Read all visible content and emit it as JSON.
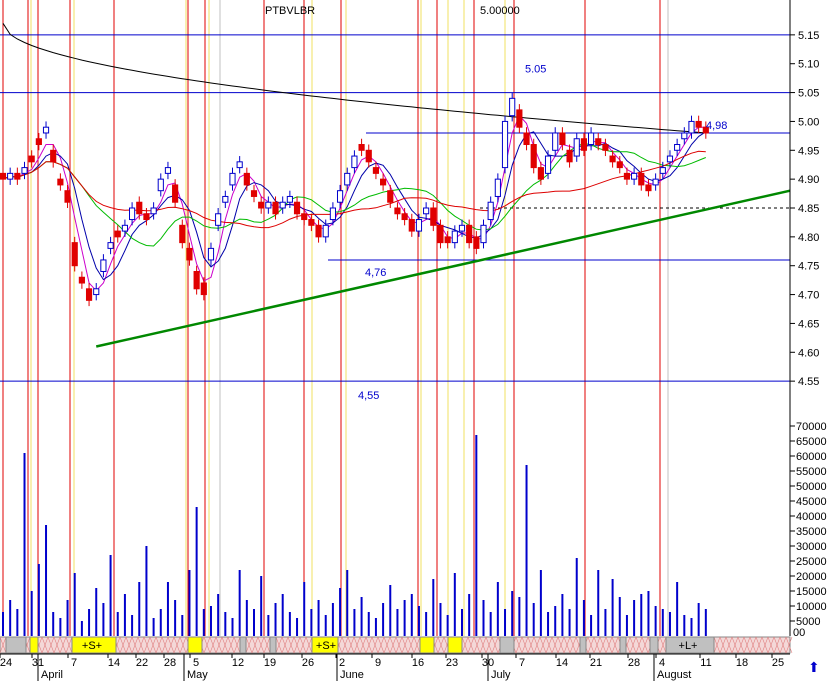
{
  "chart_data": {
    "type": "candlestick",
    "title": "PTBVLBR",
    "legend_text": "5.00000",
    "price_axis": {
      "ylim": [
        4.5,
        5.2
      ],
      "ticks": [
        4.55,
        4.6,
        4.65,
        4.7,
        4.75,
        4.8,
        4.85,
        4.9,
        4.95,
        5.0,
        5.05,
        5.1,
        5.15
      ]
    },
    "volume_axis": {
      "ylim": [
        0,
        72000
      ],
      "ticks": [
        5000,
        10000,
        15000,
        20000,
        25000,
        30000,
        35000,
        40000,
        45000,
        50000,
        55000,
        60000,
        65000,
        70000
      ]
    },
    "date_ticks": [
      "24",
      "31",
      "7",
      "14",
      "22",
      "28",
      "5",
      "12",
      "19",
      "26",
      "2",
      "9",
      "16",
      "23",
      "30",
      "7",
      "14",
      "21",
      "28",
      "4",
      "11",
      "18",
      "25"
    ],
    "month_labels": [
      "April",
      "May",
      "June",
      "July",
      "August"
    ],
    "horizontal_levels": [
      {
        "value": 5.15,
        "label": ""
      },
      {
        "value": 5.05,
        "label": "5.05"
      },
      {
        "value": 4.76,
        "label": "4,76"
      },
      {
        "value": 4.55,
        "label": "4,55"
      },
      {
        "value": 4.98,
        "label": "4,98"
      },
      {
        "value": 4.85,
        "label": ""
      }
    ],
    "trendline": {
      "from": [
        13,
        4.61
      ],
      "to": [
        133,
        4.88
      ]
    },
    "signals": [
      "+S+",
      "+S+",
      "+L+"
    ],
    "close": [
      4.9,
      4.91,
      4.9,
      4.92,
      4.93,
      4.96,
      4.99,
      4.93,
      4.89,
      4.86,
      4.75,
      4.72,
      4.69,
      4.71,
      4.76,
      4.79,
      4.8,
      4.82,
      4.85,
      4.84,
      4.83,
      4.85,
      4.9,
      4.92,
      4.86,
      4.79,
      4.76,
      4.71,
      4.7,
      4.78,
      4.84,
      4.87,
      4.91,
      4.93,
      4.89,
      4.87,
      4.85,
      4.86,
      4.84,
      4.86,
      4.87,
      4.84,
      4.83,
      4.82,
      4.8,
      4.82,
      4.85,
      4.88,
      4.91,
      4.94,
      4.95,
      4.93,
      4.91,
      4.89,
      4.86,
      4.84,
      4.83,
      4.81,
      4.83,
      4.85,
      4.82,
      4.79,
      4.79,
      4.81,
      4.82,
      4.79,
      4.78,
      4.82,
      4.86,
      4.9,
      5.0,
      5.04,
      4.99,
      4.96,
      4.92,
      4.9,
      4.94,
      4.98,
      4.96,
      4.93,
      4.97,
      4.95,
      4.98,
      4.96,
      4.95,
      4.93,
      4.92,
      4.9,
      4.91,
      4.89,
      4.88,
      4.9,
      4.92,
      4.94,
      4.96,
      4.98,
      5.0,
      4.99,
      4.98
    ],
    "open": [
      4.91,
      4.9,
      4.91,
      4.91,
      4.94,
      4.97,
      4.98,
      4.95,
      4.9,
      4.88,
      4.79,
      4.73,
      4.71,
      4.7,
      4.74,
      4.78,
      4.81,
      4.81,
      4.83,
      4.86,
      4.84,
      4.84,
      4.88,
      4.91,
      4.89,
      4.82,
      4.78,
      4.74,
      4.72,
      4.76,
      4.82,
      4.86,
      4.89,
      4.92,
      4.91,
      4.88,
      4.86,
      4.85,
      4.86,
      4.85,
      4.86,
      4.86,
      4.84,
      4.83,
      4.82,
      4.8,
      4.83,
      4.86,
      4.89,
      4.92,
      4.96,
      4.95,
      4.92,
      4.9,
      4.88,
      4.85,
      4.84,
      4.83,
      4.81,
      4.84,
      4.85,
      4.82,
      4.8,
      4.79,
      4.81,
      4.82,
      4.8,
      4.79,
      4.83,
      4.87,
      4.92,
      5.01,
      5.02,
      4.98,
      4.96,
      4.92,
      4.91,
      4.95,
      4.98,
      4.95,
      4.94,
      4.97,
      4.96,
      4.97,
      4.96,
      4.94,
      4.93,
      4.91,
      4.9,
      4.91,
      4.89,
      4.89,
      4.91,
      4.93,
      4.95,
      4.97,
      4.98,
      5.0,
      4.99
    ],
    "volume": [
      8000,
      12000,
      9000,
      61000,
      15000,
      24000,
      37000,
      8000,
      6000,
      12000,
      21000,
      5000,
      9000,
      16000,
      11000,
      27000,
      8000,
      14000,
      7000,
      18000,
      30000,
      6000,
      9000,
      18000,
      12000,
      7000,
      22000,
      43000,
      9000,
      10000,
      14000,
      8000,
      6000,
      22000,
      12000,
      9000,
      20000,
      7000,
      11000,
      14000,
      8000,
      6000,
      18000,
      9000,
      12000,
      7000,
      11000,
      16000,
      22000,
      9000,
      13000,
      8000,
      6000,
      11000,
      17000,
      9000,
      12000,
      14000,
      10000,
      8000,
      19000,
      11000,
      7000,
      21000,
      9000,
      14000,
      67000,
      12000,
      8000,
      18000,
      9000,
      15000,
      13000,
      57000,
      11000,
      22000,
      8000,
      10000,
      14000,
      9000,
      26000,
      12000,
      7000,
      22000,
      9000,
      19000,
      13000,
      7000,
      12000,
      14000,
      15000,
      10000,
      9000,
      8000,
      18000,
      7000,
      6000,
      11000,
      9000
    ]
  },
  "ui": {
    "up_arrow": "⬆",
    "corner_label": "00"
  }
}
